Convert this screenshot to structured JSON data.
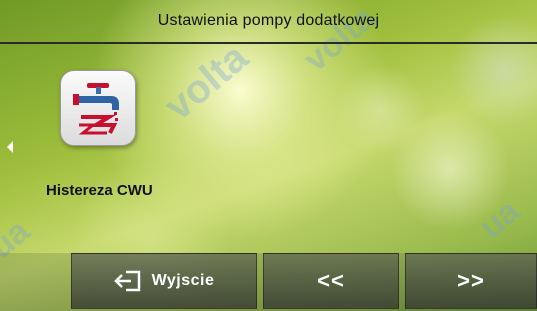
{
  "header": {
    "title": "Ustawienia pompy dodatkowej"
  },
  "parameter": {
    "label": "Histereza CWU",
    "icon": "hot-water-tap-icon"
  },
  "side_nav": {
    "icon": "left-arrow-icon"
  },
  "navbar": {
    "exit": {
      "label": "Wyjscie",
      "icon": "exit-icon"
    },
    "prev": {
      "label": "<<"
    },
    "next": {
      "label": ">>"
    }
  },
  "watermarks": [
    "volta",
    "ua",
    "volta",
    "ua"
  ]
}
